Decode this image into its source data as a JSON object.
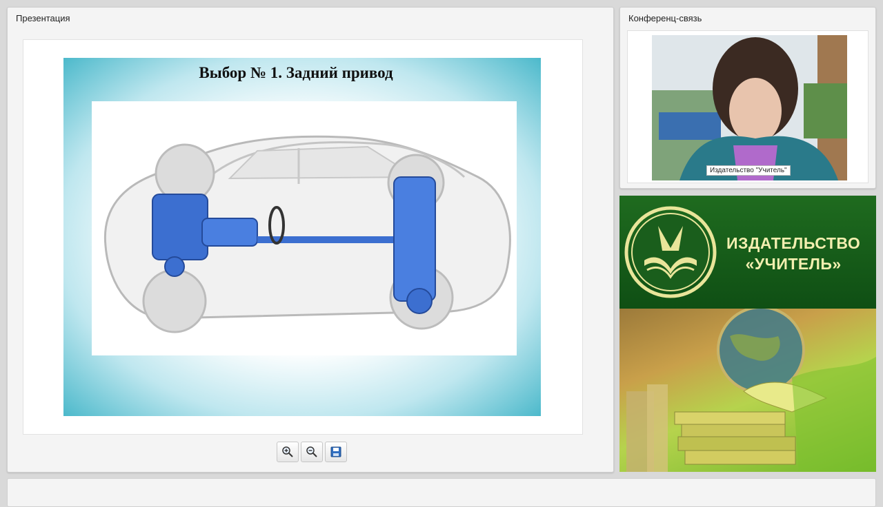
{
  "presentation": {
    "title": "Презентация",
    "slide_title": "Выбор № 1. Задний привод"
  },
  "toolbar": {
    "zoom_in_icon": "zoom-in-icon",
    "zoom_out_icon": "zoom-out-icon",
    "save_icon": "save-icon"
  },
  "conference": {
    "title": "Конференц-связь",
    "caption": "Издательство \"Учитель\""
  },
  "banner": {
    "line1": "ИЗДАТЕЛЬСТВО",
    "line2": "«УЧИТЕЛЬ»"
  },
  "colors": {
    "slide_accent": "#4cb9cb",
    "banner_green": "#1f6b1f",
    "banner_text": "#f3efb0",
    "car_blue": "#3c6fd0"
  }
}
